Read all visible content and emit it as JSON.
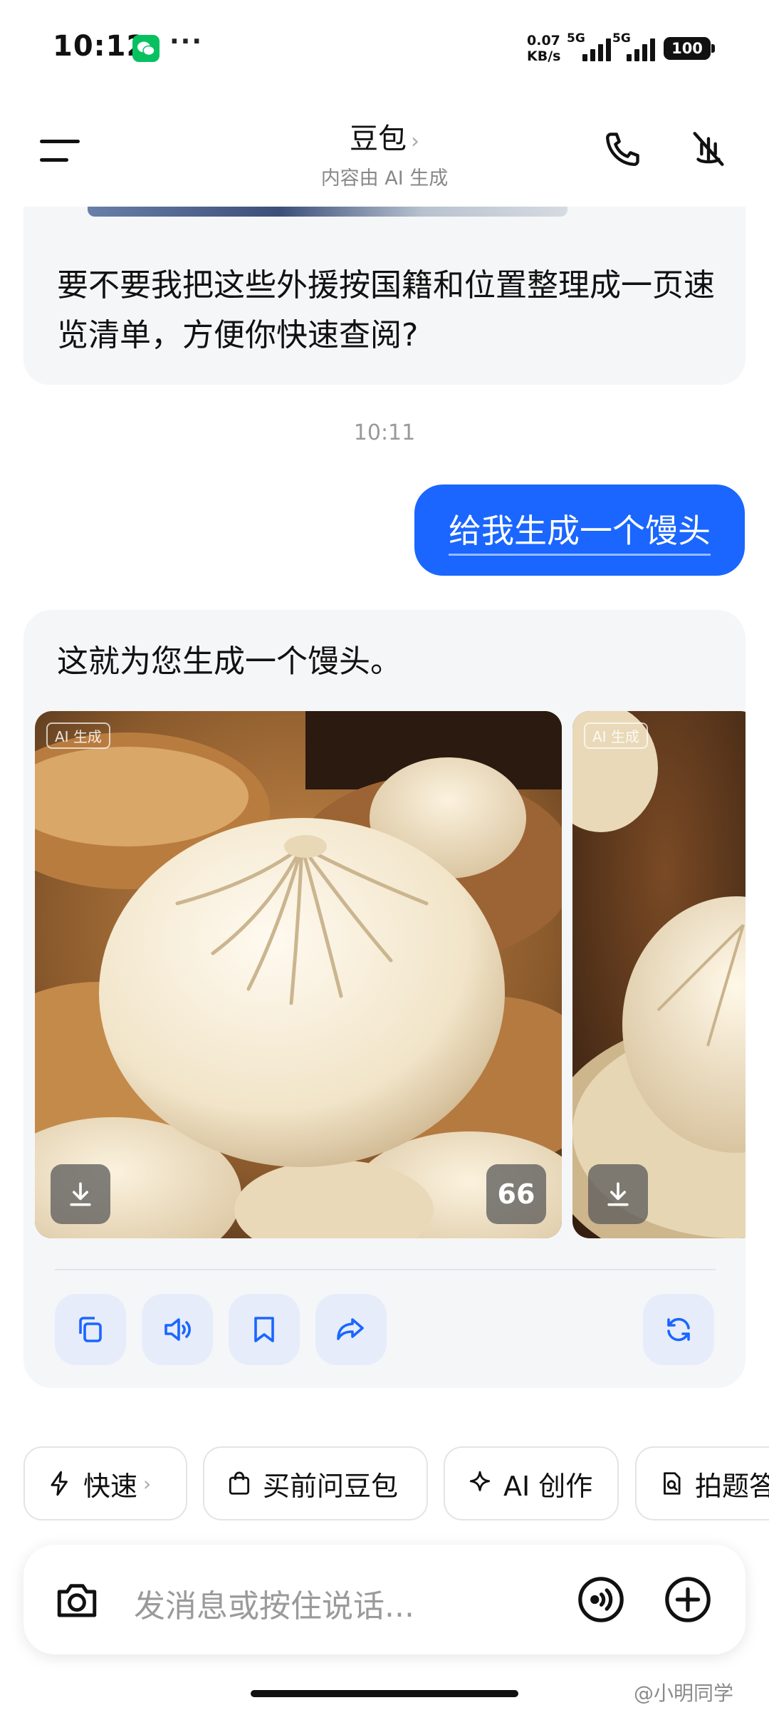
{
  "status_bar": {
    "time": "10:12",
    "more": "···",
    "net_speed_value": "0.07",
    "net_speed_unit": "KB/s",
    "sim1_label": "5G",
    "sim2_label": "5G",
    "battery": "100"
  },
  "header": {
    "title": "豆包",
    "title_chevron": "›",
    "subtitle": "内容由 AI 生成"
  },
  "chat": {
    "previous_bot_message": "要不要我把这些外援按国籍和位置整理成一页速览清单，方便你快速查阅?",
    "timestamp": "10:11",
    "user_message": "给我生成一个馒头",
    "bot_reply": "这就为您生成一个馒头。",
    "images": [
      {
        "tag": "AI 生成",
        "quote_label": "66"
      },
      {
        "tag": "AI 生成"
      }
    ]
  },
  "quick_actions": [
    {
      "label": "快速",
      "icon": "lightning-icon",
      "chevron": "›"
    },
    {
      "label": "买前问豆包",
      "icon": "shopping-bag-icon"
    },
    {
      "label": "AI 创作",
      "icon": "sparkle-icon"
    },
    {
      "label": "拍题答疑",
      "icon": "photo-question-icon"
    }
  ],
  "input": {
    "placeholder": "发消息或按住说话..."
  },
  "watermark": "@小明同学",
  "colors": {
    "accent": "#1a66ff",
    "card_bg": "#f5f6f8",
    "action_btn_bg": "#e6ecfa"
  }
}
